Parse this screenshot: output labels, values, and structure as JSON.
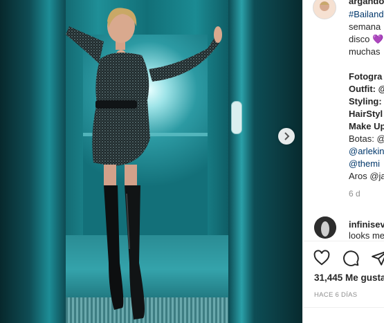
{
  "post": {
    "username": "argando",
    "caption_lines": [
      {
        "text": "#Bailando",
        "style": "link"
      },
      {
        "text": "semana",
        "style": "normal"
      },
      {
        "text": "disco 💜",
        "style": "normal"
      },
      {
        "text": "muchas",
        "style": "normal"
      },
      {
        "text": "",
        "style": "normal"
      },
      {
        "text": "Fotogra",
        "style": "bold"
      },
      {
        "text": "Outfit: @",
        "style": "bold"
      },
      {
        "text": "Styling:",
        "style": "bold"
      },
      {
        "text": "HairStyl",
        "style": "bold"
      },
      {
        "text": "Make Up",
        "style": "bold"
      },
      {
        "text": "Botas: @",
        "style": "normal"
      },
      {
        "text": "@arlekin",
        "style": "link"
      },
      {
        "text": "@themi",
        "style": "link"
      },
      {
        "text": "Aros @ja",
        "style": "normal"
      }
    ],
    "posted": "6 d"
  },
  "comment": {
    "username": "infinisev",
    "text": "looks me"
  },
  "stats": {
    "likes": "31,445 Me gusta",
    "time_ago": "HACE 6 DÍAS"
  },
  "icons": {
    "next": "chevron-right-icon",
    "like": "heart-icon",
    "comment": "comment-icon",
    "share": "share-icon"
  },
  "colors": {
    "link": "#00376b",
    "text": "#262626",
    "muted": "#8e8e8e",
    "photo_teal": "#1b8a93"
  }
}
